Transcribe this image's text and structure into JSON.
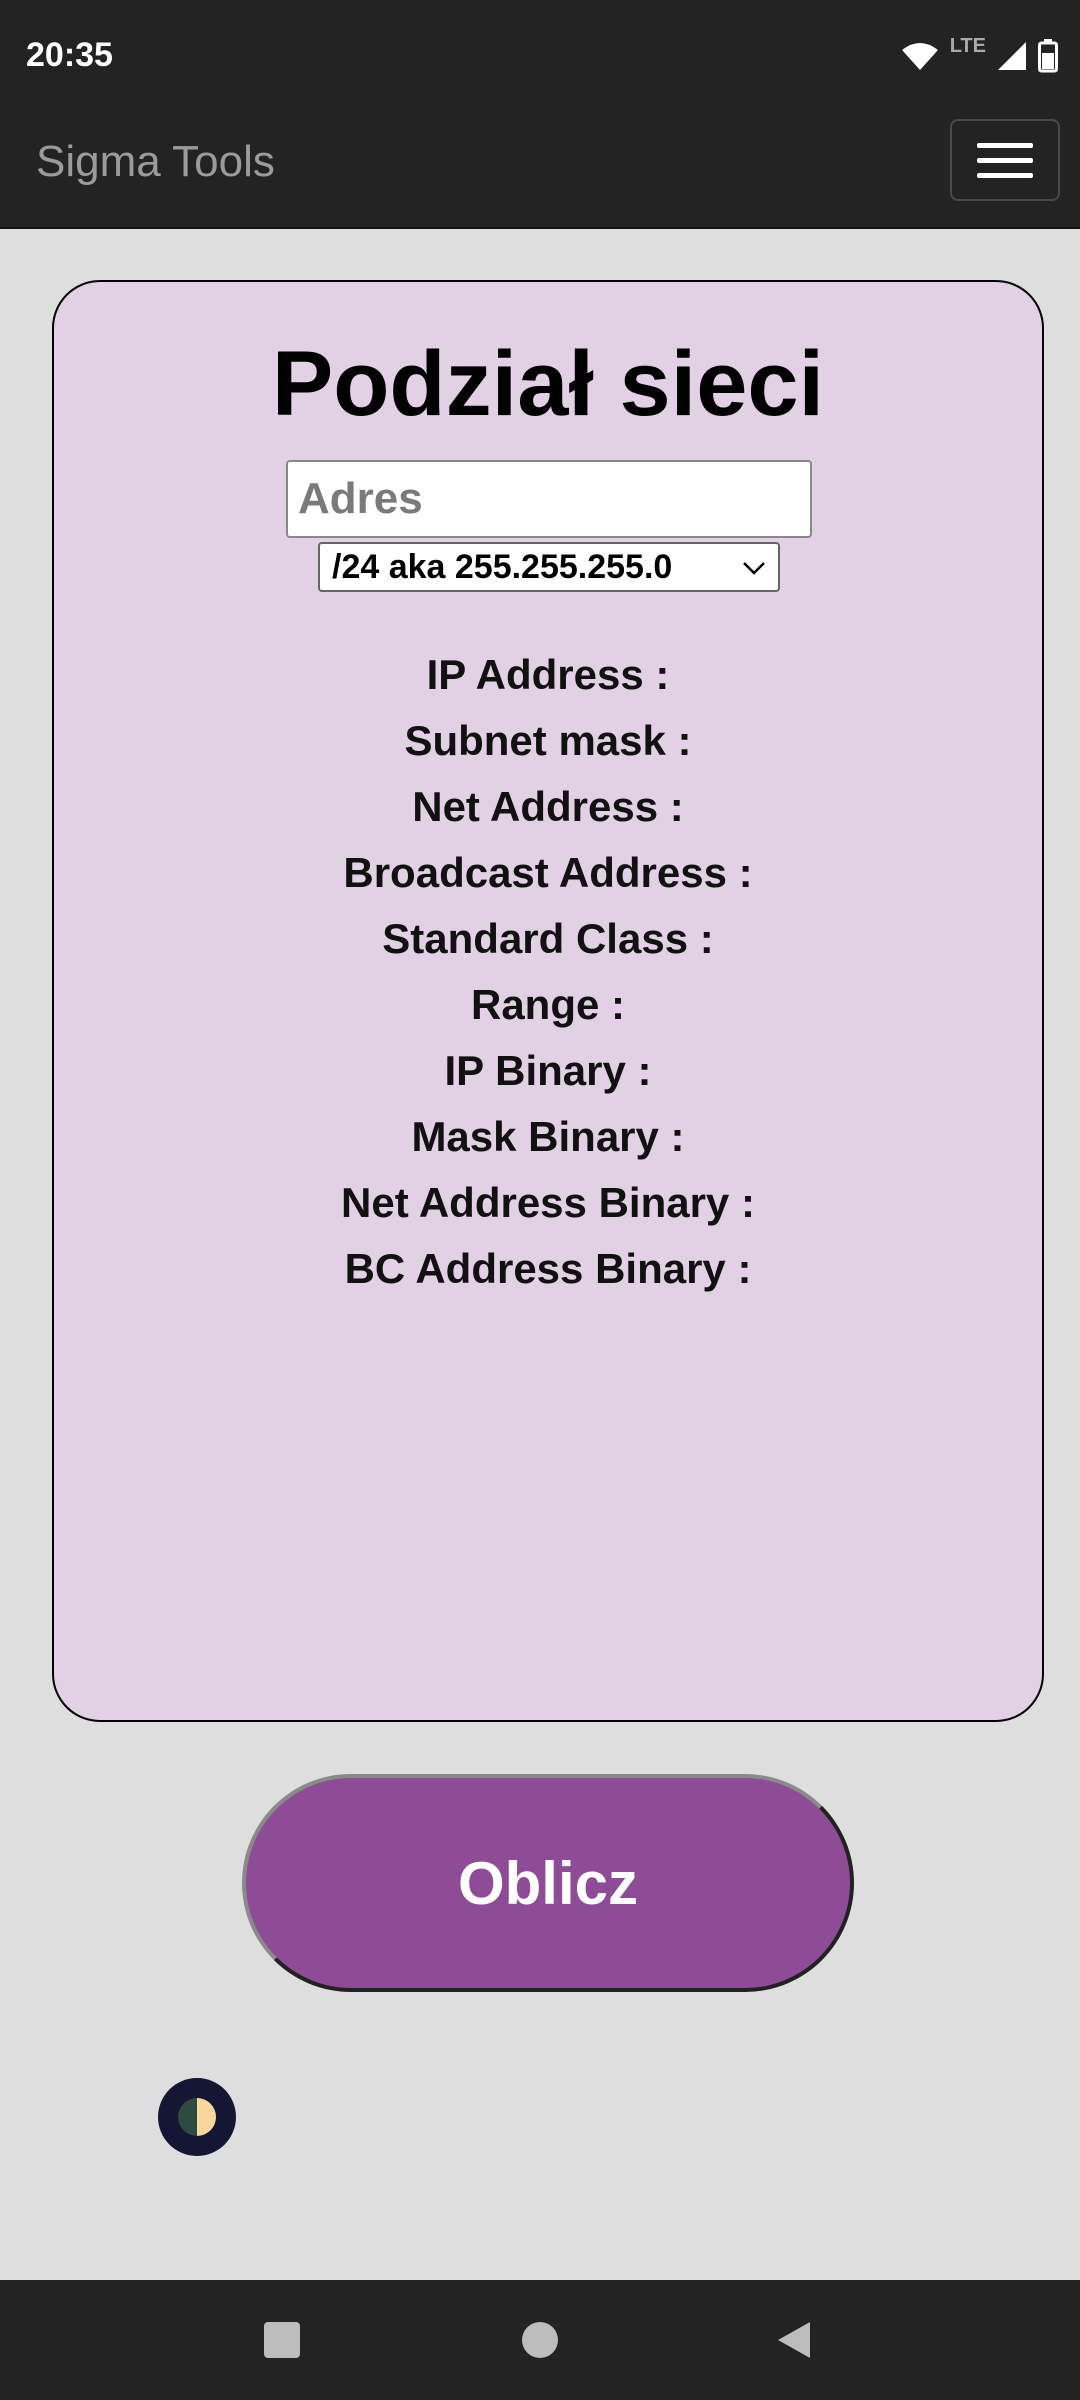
{
  "status": {
    "time": "20:35",
    "network": "LTE"
  },
  "navbar": {
    "brand": "Sigma Tools"
  },
  "card": {
    "title": "Podział sieci",
    "address_input": {
      "placeholder": "Adres",
      "value": ""
    },
    "mask_select": {
      "selected": "/24 aka 255.255.255.0"
    },
    "results": [
      "IP Address :",
      "Subnet mask :",
      "Net Address :",
      "Broadcast Address :",
      "Standard Class :",
      "Range :",
      "IP Binary :",
      "Mask Binary :",
      "Net Address Binary :",
      "BC Address Binary :"
    ]
  },
  "actions": {
    "calculate_label": "Oblicz"
  },
  "colors": {
    "bar": "#232323",
    "page_bg": "#dedede",
    "card_bg": "#e2d0e4",
    "button": "#8e4c97",
    "toggle": "#141633"
  },
  "icons": {
    "status": [
      "wifi-icon",
      "signal-icon",
      "battery-icon"
    ],
    "menu": "hamburger-menu-icon",
    "theme": "half-moon-icon",
    "system_nav": [
      "square-icon",
      "circle-icon",
      "back-triangle-icon"
    ]
  }
}
